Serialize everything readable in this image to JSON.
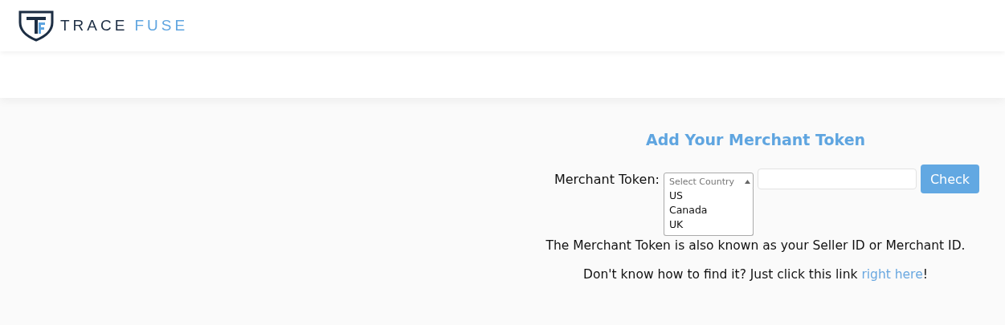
{
  "logo": {
    "word_1": "TRACE",
    "word_2": "FUSE"
  },
  "form": {
    "title": "Add Your Merchant Token",
    "label": "Merchant Token:",
    "select": {
      "placeholder": "Select Country",
      "expanded": true,
      "options": [
        {
          "label": "US"
        },
        {
          "label": "Canada"
        },
        {
          "label": "UK"
        }
      ]
    },
    "button": "Check"
  },
  "info": "The Merchant Token is also known as your Seller ID or Merchant ID.",
  "help": {
    "text_before": "Don't know how to find it? Just click this link ",
    "link": "right here",
    "text_after": "!"
  }
}
